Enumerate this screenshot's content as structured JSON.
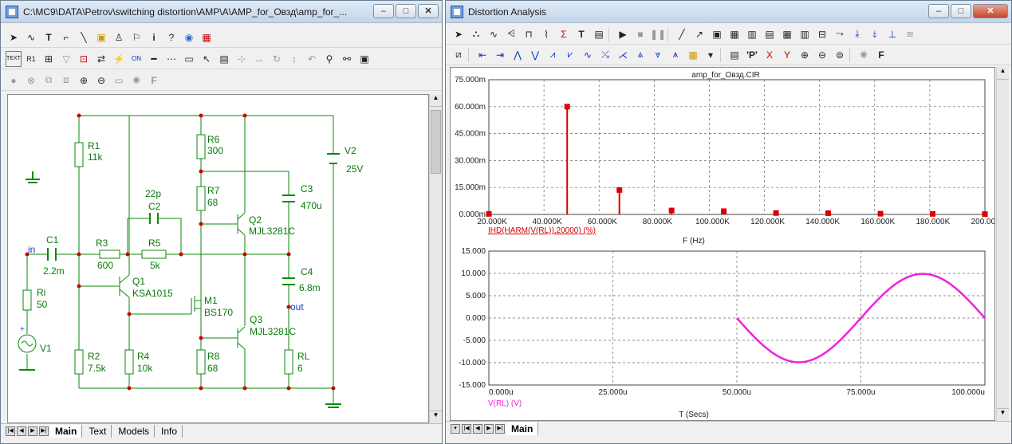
{
  "schematic_window": {
    "title": "C:\\MC9\\DATA\\Petrov\\switching distortion\\AMP\\A\\AMP_for_Овзд\\amp_for_...",
    "tabs": [
      {
        "label": "Main",
        "active": true
      },
      {
        "label": "Text",
        "active": false
      },
      {
        "label": "Models",
        "active": false
      },
      {
        "label": "Info",
        "active": false
      }
    ],
    "components": {
      "R1": {
        "name": "R1",
        "value": "11k"
      },
      "R2": {
        "name": "R2",
        "value": "7.5k"
      },
      "R3": {
        "name": "R3",
        "value": "600"
      },
      "R4": {
        "name": "R4",
        "value": "10k"
      },
      "R5": {
        "name": "R5",
        "value": "5k"
      },
      "R6": {
        "name": "R6",
        "value": "300"
      },
      "R7": {
        "name": "R7",
        "value": "68"
      },
      "R8": {
        "name": "R8",
        "value": "68"
      },
      "Ri": {
        "name": "Ri",
        "value": "50"
      },
      "RL": {
        "name": "RL",
        "value": "6"
      },
      "C1": {
        "name": "C1",
        "value": "2.2m"
      },
      "C2": {
        "name": "C2",
        "value": "22p"
      },
      "C3": {
        "name": "C3",
        "value": "470u"
      },
      "C4": {
        "name": "C4",
        "value": "6.8m"
      },
      "Q1": {
        "name": "Q1",
        "value": "KSA1015"
      },
      "Q2": {
        "name": "Q2",
        "value": "MJL3281C"
      },
      "Q3": {
        "name": "Q3",
        "value": "MJL3281C"
      },
      "M1": {
        "name": "M1",
        "value": "BS170"
      },
      "V1": {
        "name": "V1"
      },
      "V2": {
        "name": "V2",
        "value": "25V"
      }
    },
    "nodes": {
      "in": "in",
      "out": "out"
    }
  },
  "analysis_window": {
    "title": "Distortion Analysis",
    "tabs": [
      {
        "label": "Main",
        "active": true
      }
    ],
    "colors": {
      "harmonic_marker": "#dd0000",
      "waveform": "#ee22dd",
      "grid": "#6a6a6a"
    },
    "chart_data": [
      {
        "type": "bar",
        "title": "amp_for_Овзд.CIR",
        "xlabel": "F (Hz)",
        "ylabel": "",
        "series": [
          {
            "name": "IHD(HARM(V(RL)),20000) (%)"
          }
        ],
        "xlim": [
          10000,
          200000
        ],
        "ylim": [
          0,
          0.075
        ],
        "x_ticks": [
          "20.000K",
          "40.000K",
          "60.000K",
          "80.000K",
          "100.000K",
          "120.000K",
          "140.000K",
          "160.000K",
          "180.000K",
          "200.000K"
        ],
        "y_ticks": [
          "75.000m",
          "60.000m",
          "45.000m",
          "30.000m",
          "15.000m",
          "0.000m"
        ],
        "x": [
          10000,
          40000,
          60000,
          80000,
          100000,
          120000,
          140000,
          160000,
          180000,
          200000
        ],
        "values": [
          0.0003,
          0.06,
          0.0136,
          0.0022,
          0.0018,
          0.0008,
          0.0007,
          0.0004,
          0.0003,
          0.0002
        ],
        "grid": true
      },
      {
        "type": "line",
        "xlabel": "T (Secs)",
        "ylabel": "",
        "series": [
          {
            "name": "V(RL) (V)"
          }
        ],
        "xlim": [
          0,
          0.0001
        ],
        "ylim": [
          -15,
          15
        ],
        "x_ticks": [
          "0.000u",
          "25.000u",
          "50.000u",
          "75.000u",
          "100.000u"
        ],
        "y_ticks": [
          "15.000",
          "10.000",
          "5.000",
          "0.000",
          "-5.000",
          "-10.000",
          "-15.000"
        ],
        "amplitude": 9.9,
        "frequency_hz": 20000,
        "t_start": 5e-05,
        "t_end": 0.0001,
        "phase": "negative-sine",
        "grid": true
      }
    ]
  }
}
